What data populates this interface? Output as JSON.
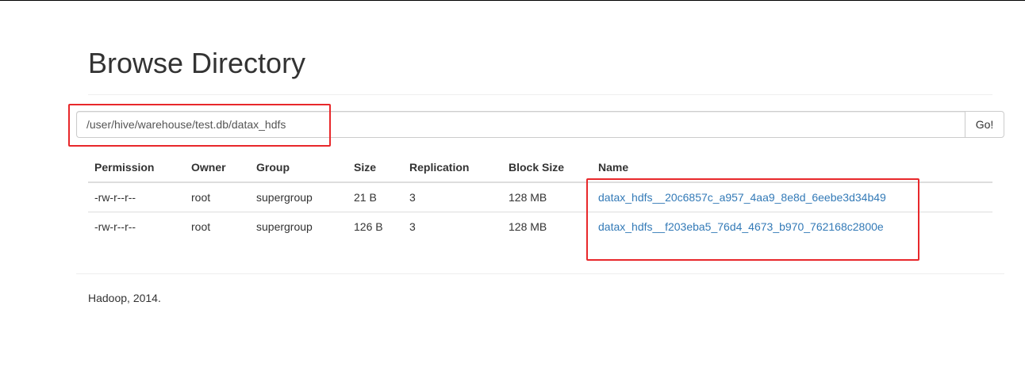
{
  "page": {
    "title": "Browse Directory"
  },
  "path_bar": {
    "value": "/user/hive/warehouse/test.db/datax_hdfs",
    "go_label": "Go!"
  },
  "table": {
    "headers": [
      "Permission",
      "Owner",
      "Group",
      "Size",
      "Replication",
      "Block Size",
      "Name"
    ],
    "rows": [
      {
        "permission": "-rw-r--r--",
        "owner": "root",
        "group": "supergroup",
        "size": "21 B",
        "replication": "3",
        "block_size": "128 MB",
        "name": "datax_hdfs__20c6857c_a957_4aa9_8e8d_6eebe3d34b49"
      },
      {
        "permission": "-rw-r--r--",
        "owner": "root",
        "group": "supergroup",
        "size": "126 B",
        "replication": "3",
        "block_size": "128 MB",
        "name": "datax_hdfs__f203eba5_76d4_4673_b970_762168c2800e"
      }
    ]
  },
  "footer": {
    "text": "Hadoop, 2014."
  },
  "colors": {
    "link": "#337ab7",
    "annotation_box": "#e8282b",
    "text": "#333333"
  }
}
